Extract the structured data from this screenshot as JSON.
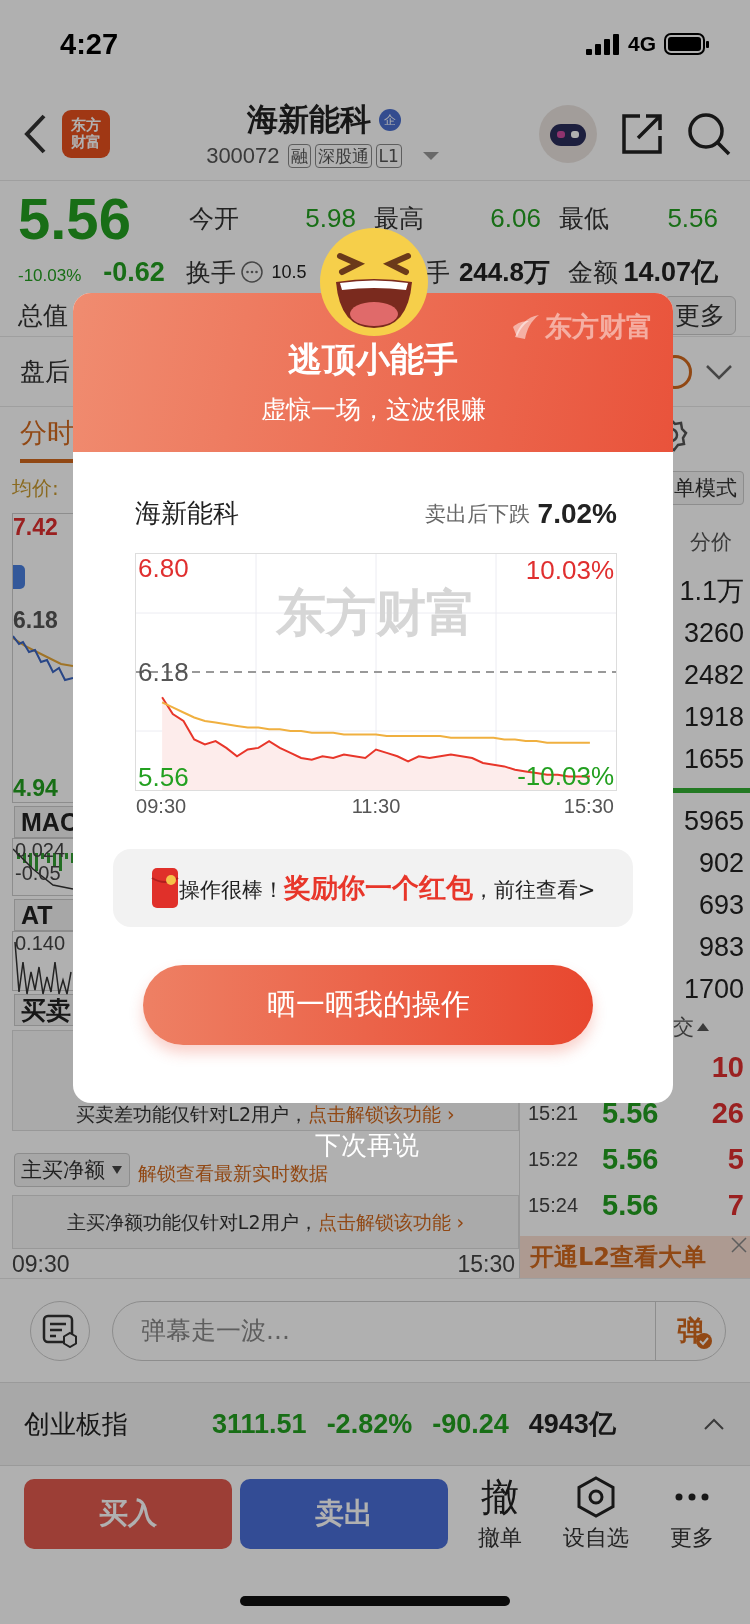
{
  "status_bar": {
    "time": "4:27",
    "network": "4G"
  },
  "header": {
    "logo": [
      "东方",
      "财富"
    ],
    "title": "海新能科",
    "title_badge": "企",
    "code": "300072",
    "tags": [
      "融",
      "深股通",
      "L1"
    ]
  },
  "quote": {
    "price": "5.56",
    "change_pct": "-10.03%",
    "change": "-0.62",
    "stats": [
      {
        "label": "今开",
        "value": "5.98"
      },
      {
        "label": "最高",
        "value": "6.06"
      },
      {
        "label": "最低",
        "value": "5.56"
      }
    ],
    "turnover": {
      "label": "换手",
      "value": "10.5"
    },
    "volume": {
      "label": "手",
      "value": "244.8万"
    },
    "amount": {
      "label": "金额",
      "value": "14.07亿"
    },
    "total_label": "总值",
    "more_button": "更多"
  },
  "after_hours": {
    "label": "盘后",
    "on": true
  },
  "tabs": [
    {
      "label": "分时",
      "selected": true
    }
  ],
  "chart_panel": {
    "avg_label": "均价:",
    "price_labels": [
      "7.42",
      "6.18",
      "4.94"
    ],
    "indicators": [
      {
        "label": "MAC",
        "values": [
          "0.024",
          "-0.05"
        ]
      },
      {
        "label": "AT",
        "values": [
          "0.140"
        ]
      }
    ],
    "buy_sell_label": "买卖",
    "buy_sell_notice": {
      "text": "买卖差功能仅针对L2用户，",
      "link": "点击解锁该功能 ›"
    },
    "net_buy_dropdown": "主买净额",
    "net_buy_hint": "解锁查看最新实时数据",
    "net_buy_notice": {
      "text": "主买净额功能仅针对L2用户，",
      "link": "点击解锁该功能 ›"
    },
    "time_axis": [
      "09:30",
      "15:30"
    ]
  },
  "order_panel": {
    "mode_button": "单模式",
    "price_header": "分价",
    "price_volumes": [
      "1.1万",
      "3260",
      "2482",
      "1918",
      "1655"
    ],
    "volumes": [
      "5965",
      "902",
      "693",
      "983",
      "1700"
    ],
    "trades_header": "交",
    "trades": [
      {
        "volume": "10"
      },
      {
        "time": "15:21",
        "price": "5.56",
        "volume": "26"
      },
      {
        "time": "15:22",
        "price": "5.56",
        "volume": "5"
      },
      {
        "time": "15:24",
        "price": "5.56",
        "volume": "7"
      }
    ],
    "banner": "开通L2查看大单"
  },
  "popup": {
    "title": "逃顶小能手",
    "subtitle": "虚惊一场，这波很赚",
    "brand": "东方财富",
    "stock": "海新能科",
    "result_label": "卖出后下跌",
    "result_value": "7.02%",
    "watermark": "东方财富",
    "chart_mid_label": "11:30",
    "chart_data": {
      "type": "line",
      "x": [
        570,
        579,
        588,
        597,
        606,
        615,
        624,
        633,
        642,
        651,
        660,
        669,
        678,
        687,
        696,
        705,
        714,
        723,
        732,
        741,
        750,
        759,
        768,
        777,
        786,
        795,
        804,
        813,
        822,
        831,
        840,
        849,
        858,
        867,
        876,
        885,
        894,
        903,
        912,
        921,
        930
      ],
      "xlim": [
        548,
        952
      ],
      "ylim": [
        5.48,
        6.88
      ],
      "xticks": [
        {
          "value": 570,
          "label": "09:30"
        },
        {
          "value": 930,
          "label": "15:30"
        }
      ],
      "yticks": [
        {
          "value": 6.8,
          "label": "6.80"
        },
        {
          "value": 6.18,
          "label": "6.18"
        },
        {
          "value": 5.56,
          "label": "5.56"
        }
      ],
      "series": [
        {
          "color": "#e8362a",
          "values": [
            6.03,
            5.93,
            5.89,
            5.78,
            5.75,
            5.77,
            5.73,
            5.68,
            5.72,
            5.73,
            5.77,
            5.73,
            5.7,
            5.67,
            5.66,
            5.68,
            5.67,
            5.69,
            5.68,
            5.67,
            5.72,
            5.7,
            5.68,
            5.65,
            5.68,
            5.67,
            5.68,
            5.69,
            5.68,
            5.67,
            5.64,
            5.63,
            5.62,
            5.6,
            5.59,
            5.58,
            5.57,
            5.57,
            5.56,
            5.56,
            5.56
          ]
        },
        {
          "color": "#f0b040",
          "values": [
            6.0,
            5.97,
            5.94,
            5.91,
            5.89,
            5.88,
            5.87,
            5.86,
            5.85,
            5.85,
            5.84,
            5.84,
            5.83,
            5.83,
            5.82,
            5.82,
            5.82,
            5.81,
            5.81,
            5.81,
            5.81,
            5.8,
            5.8,
            5.8,
            5.8,
            5.8,
            5.8,
            5.79,
            5.79,
            5.79,
            5.79,
            5.79,
            5.78,
            5.78,
            5.77,
            5.77,
            5.76,
            5.76,
            5.76,
            5.76,
            5.76
          ]
        }
      ],
      "annotations": [
        "10.03%",
        "-10.03%"
      ]
    },
    "reward": "操作很棒！**奖励你一个红包**，前往查看>",
    "share_button": "晒一晒我的操作",
    "dismiss": "下次再说"
  },
  "comment_bar": {
    "placeholder": "弹幕走一波...",
    "send": "弹"
  },
  "index_bar": {
    "name": "创业板指",
    "values": [
      "3111.51",
      "-2.82%",
      "-90.24"
    ],
    "amount": "4943亿"
  },
  "trade_bar": {
    "buy": "买入",
    "sell": "卖出",
    "actions": [
      {
        "kind": "glyph",
        "glyph": "撤",
        "label": "撤单"
      },
      {
        "kind": "hexagon",
        "label": "设自选"
      },
      {
        "kind": "dots",
        "label": "更多"
      }
    ]
  }
}
